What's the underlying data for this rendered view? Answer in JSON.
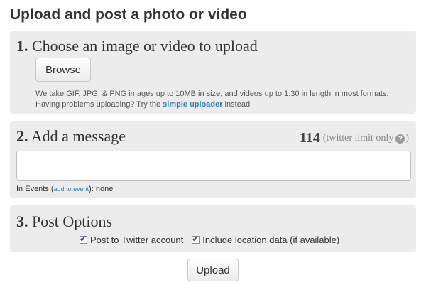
{
  "page": {
    "title": "Upload and post a photo or video"
  },
  "step1": {
    "number": "1.",
    "title": "Choose an image or video to upload",
    "browse_label": "Browse",
    "help_line1": "We take GIF, JPG, & PNG images up to 10MB in size, and videos up to 1:30 in length in most formats.",
    "help_line2_prefix": "Having problems uploading? Try the ",
    "simple_uploader_link": "simple uploader",
    "help_line2_suffix": " instead."
  },
  "step2": {
    "number": "2.",
    "title": "Add a message",
    "char_count": "114",
    "limit_note_prefix": "(twitter limit only",
    "help_icon": "?",
    "limit_note_suffix": ")",
    "message_value": "",
    "events_prefix": "In Events (",
    "add_to_event_link": "add to event",
    "events_suffix": "): none"
  },
  "step3": {
    "number": "3.",
    "title": "Post Options",
    "options": [
      {
        "label": "Post to Twitter account",
        "checked": true
      },
      {
        "label": "Include location data (if available)",
        "checked": true
      }
    ],
    "check_glyph": "✔"
  },
  "upload_label": "Upload",
  "colors": {
    "panel_bg": "#ececec",
    "link": "#2a7fc0",
    "text": "#333333"
  },
  "icons": {
    "help": "question-circle-icon",
    "checkbox": "checkbox-checked-icon"
  }
}
